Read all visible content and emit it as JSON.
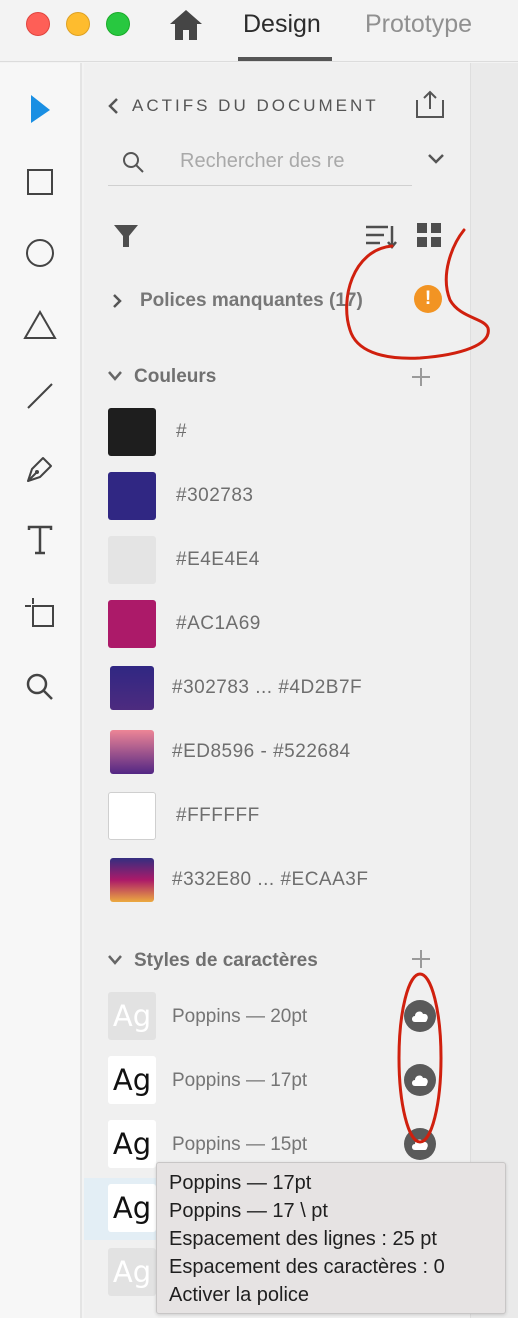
{
  "window": {
    "tabs": [
      {
        "label": "Design",
        "active": true
      },
      {
        "label": "Prototype",
        "active": false
      }
    ]
  },
  "panel": {
    "title": "ACTIFS DU DOCUMENT",
    "search_placeholder": "Rechercher des re",
    "missing_fonts": {
      "label": "Polices manquantes",
      "count": "(17)"
    },
    "colors": {
      "title": "Couleurs",
      "items": [
        {
          "label": "#",
          "fill": "#1e1e1e"
        },
        {
          "label": "#302783",
          "fill": "#302783"
        },
        {
          "label": "#E4E4E4",
          "fill": "#e4e4e4"
        },
        {
          "label": "#AC1A69",
          "fill": "#ac1a69"
        },
        {
          "label": "#302783 ... #4D2B7F",
          "gradient": [
            "#302783",
            "#4d2b7f"
          ]
        },
        {
          "label": "#ED8596 - #522684",
          "gradient": [
            "#ed8596",
            "#522684"
          ]
        },
        {
          "label": "#FFFFFF",
          "fill": "#ffffff"
        },
        {
          "label": "#332E80 ... #ECAA3F",
          "gradient": [
            "#332e80",
            "#ac1a69",
            "#ecaa3f"
          ]
        }
      ]
    },
    "char_styles": {
      "title": "Styles de caractères",
      "items": [
        {
          "preview": "Ag",
          "label": "Poppins — 20pt"
        },
        {
          "preview": "Ag",
          "label": "Poppins — 17pt"
        },
        {
          "preview": "Ag",
          "label": "Poppins — 15pt"
        },
        {
          "preview": "Ag",
          "label": ""
        },
        {
          "preview": "Ag",
          "label": ""
        }
      ]
    }
  },
  "tooltip": {
    "lines": [
      "Poppins — 17pt",
      "Poppins — 17 \\ pt",
      "Espacement des lignes : 25 pt",
      "Espacement des caractères : 0",
      "Activer la police"
    ]
  },
  "colors": {
    "accent": "#1a8fe3",
    "warning": "#f29423",
    "annotation": "#d0200e"
  }
}
